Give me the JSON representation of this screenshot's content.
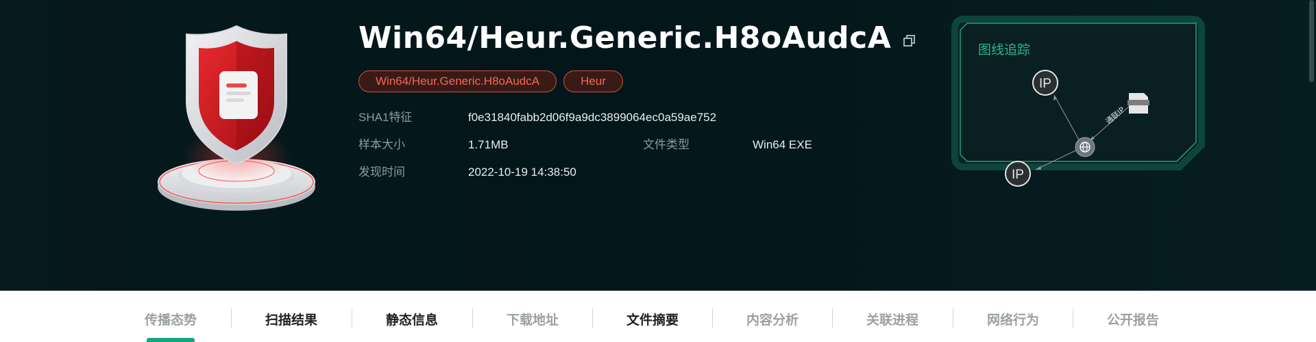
{
  "sample": {
    "name": "Win64/Heur.Generic.H8oAudcA",
    "tags": [
      "Win64/Heur.Generic.H8oAudcA",
      "Heur"
    ]
  },
  "details": {
    "sha1_label": "SHA1特征",
    "sha1_value": "f0e31840fabb2d06f9a9dc3899064ec0a59ae752",
    "size_label": "样本大小",
    "size_value": "1.71MB",
    "type_label": "文件类型",
    "type_value": "Win64 EXE",
    "time_label": "发现时间",
    "time_value": "2022-10-19 14:38:50"
  },
  "graph": {
    "title": "图线追踪",
    "node_ip_label": "IP",
    "edge_label": "通联IP"
  },
  "tabs": [
    {
      "label": "传播态势",
      "active": true
    },
    {
      "label": "扫描结果"
    },
    {
      "label": "静态信息"
    },
    {
      "label": "下载地址"
    },
    {
      "label": "文件摘要"
    },
    {
      "label": "内容分析"
    },
    {
      "label": "关联进程"
    },
    {
      "label": "网络行为"
    },
    {
      "label": "公开报告"
    }
  ],
  "colors": {
    "accent": "#17a37e",
    "danger": "#f06a53",
    "graph_green": "#2bb68a"
  }
}
